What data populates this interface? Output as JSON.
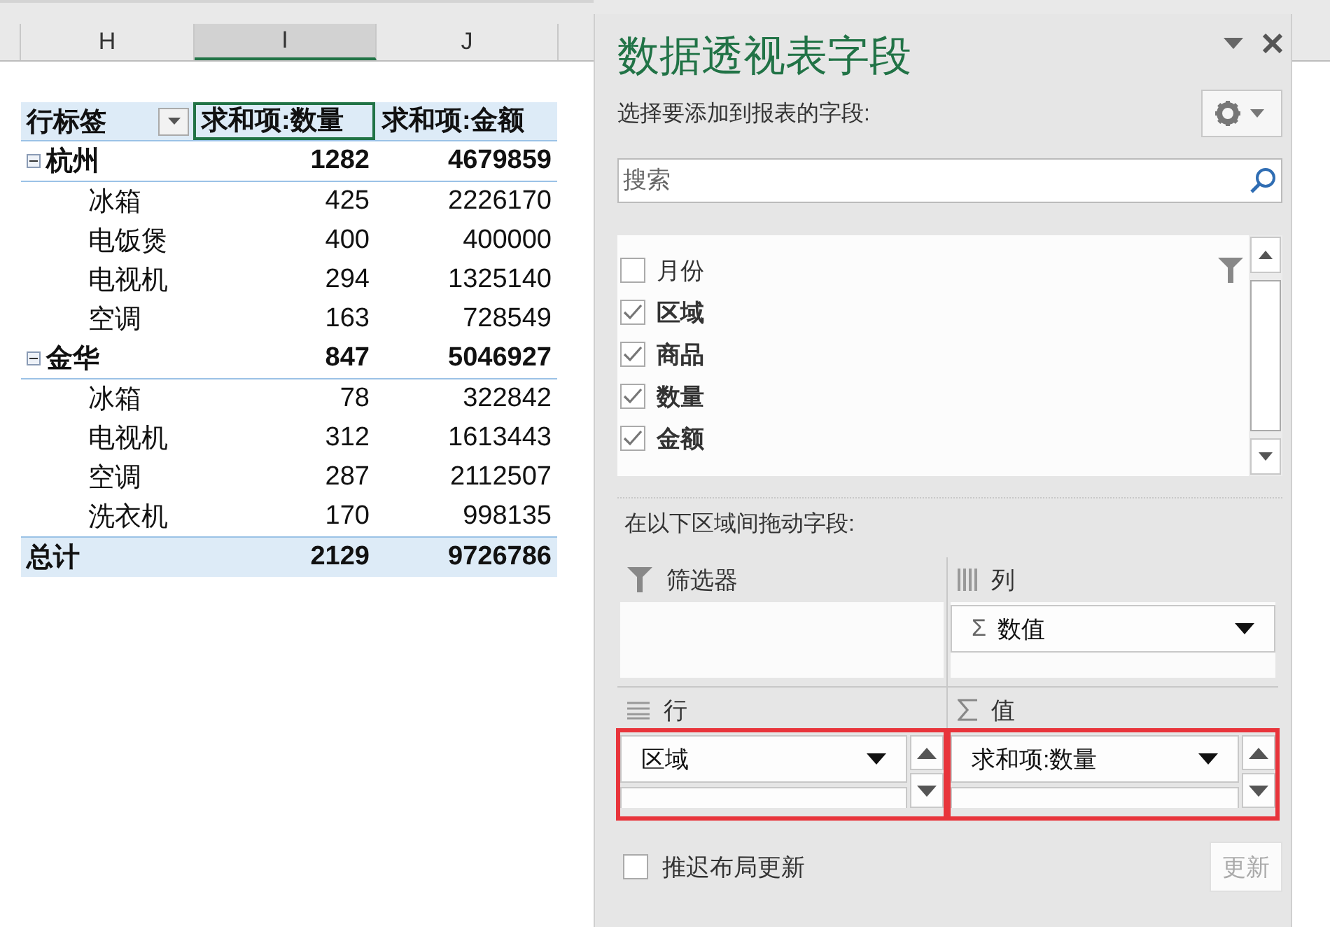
{
  "sheet": {
    "columns": [
      {
        "label": "H",
        "selected": false
      },
      {
        "label": "I",
        "selected": true
      },
      {
        "label": "J",
        "selected": false
      }
    ]
  },
  "pivot": {
    "row_label": "行标签",
    "columns": [
      {
        "label": "求和项:数量",
        "selected": true
      },
      {
        "label": "求和项:金额",
        "selected": false
      }
    ],
    "groups": [
      {
        "label": "杭州",
        "expanded": true,
        "values": [
          "1282",
          "4679859"
        ],
        "children": [
          {
            "label": "冰箱",
            "values": [
              "425",
              "2226170"
            ]
          },
          {
            "label": "电饭煲",
            "values": [
              "400",
              "400000"
            ]
          },
          {
            "label": "电视机",
            "values": [
              "294",
              "1325140"
            ]
          },
          {
            "label": "空调",
            "values": [
              "163",
              "728549"
            ]
          }
        ]
      },
      {
        "label": "金华",
        "expanded": true,
        "values": [
          "847",
          "5046927"
        ],
        "children": [
          {
            "label": "冰箱",
            "values": [
              "78",
              "322842"
            ]
          },
          {
            "label": "电视机",
            "values": [
              "312",
              "1613443"
            ]
          },
          {
            "label": "空调",
            "values": [
              "287",
              "2112507"
            ]
          },
          {
            "label": "洗衣机",
            "values": [
              "170",
              "998135"
            ]
          }
        ]
      }
    ],
    "total": {
      "label": "总计",
      "values": [
        "2129",
        "9726786"
      ]
    }
  },
  "panel": {
    "title": "数据透视表字段",
    "subtitle": "选择要添加到报表的字段:",
    "search": {
      "placeholder": "搜索"
    },
    "fields": [
      {
        "label": "月份",
        "checked": false,
        "filtered": true
      },
      {
        "label": "区域",
        "checked": true,
        "filtered": false
      },
      {
        "label": "商品",
        "checked": true,
        "filtered": false
      },
      {
        "label": "数量",
        "checked": true,
        "filtered": false
      },
      {
        "label": "金额",
        "checked": true,
        "filtered": false
      }
    ],
    "areas_hint": "在以下区域间拖动字段:",
    "areas": [
      {
        "kind": "filter",
        "label": "筛选器",
        "highlighted": false
      },
      {
        "kind": "columns",
        "label": "列",
        "highlighted": false,
        "items": [
          {
            "label": "数值",
            "prefix": "Σ"
          }
        ]
      },
      {
        "kind": "rows",
        "label": "行",
        "highlighted": true,
        "more_below": true,
        "items": [
          {
            "label": "区域"
          }
        ]
      },
      {
        "kind": "values",
        "label": "值",
        "highlighted": true,
        "more_below": true,
        "items": [
          {
            "label": "求和项:数量"
          }
        ]
      }
    ],
    "defer": {
      "label": "推迟布局更新",
      "checked": false
    },
    "update_button": {
      "label": "更新",
      "disabled": true
    }
  }
}
